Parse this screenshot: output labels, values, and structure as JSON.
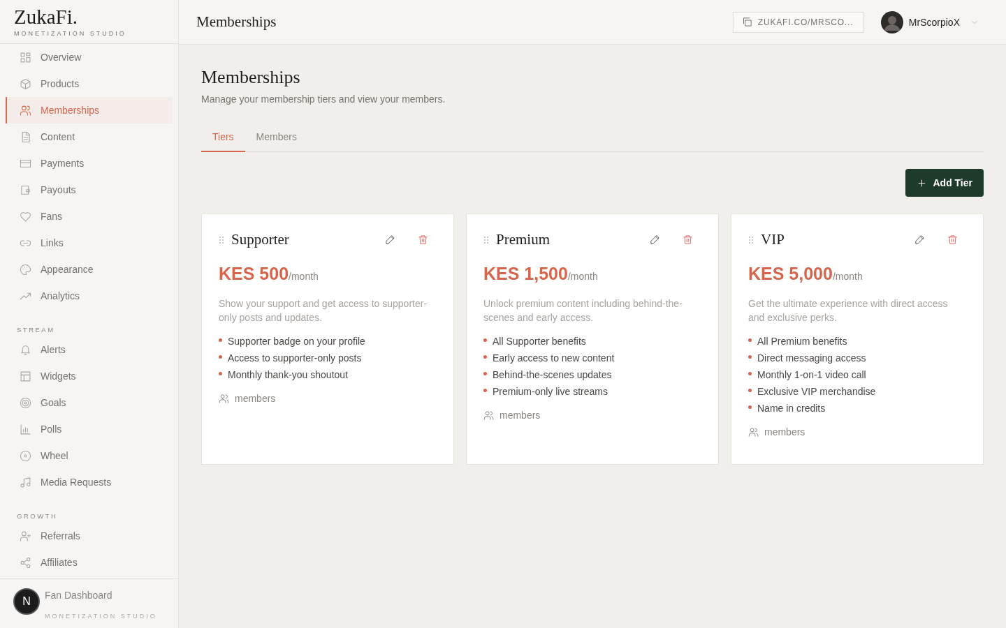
{
  "brand": {
    "name": "ZukaFi.",
    "tagline": "MONETIZATION STUDIO"
  },
  "sidebar": {
    "items": [
      {
        "label": "Overview",
        "selected": false
      },
      {
        "label": "Products",
        "selected": false
      },
      {
        "label": "Memberships",
        "selected": true
      },
      {
        "label": "Content",
        "selected": false
      },
      {
        "label": "Payments",
        "selected": false
      },
      {
        "label": "Payouts",
        "selected": false
      },
      {
        "label": "Fans",
        "selected": false
      },
      {
        "label": "Links",
        "selected": false
      },
      {
        "label": "Appearance",
        "selected": false
      },
      {
        "label": "Analytics",
        "selected": false
      }
    ],
    "sections": [
      {
        "title": "STREAM",
        "items": [
          {
            "label": "Alerts",
            "selected": false
          },
          {
            "label": "Widgets",
            "selected": false
          },
          {
            "label": "Goals",
            "selected": false
          },
          {
            "label": "Polls",
            "selected": false
          },
          {
            "label": "Wheel",
            "selected": false
          },
          {
            "label": "Media Requests",
            "selected": false
          }
        ]
      },
      {
        "title": "GROWTH",
        "items": [
          {
            "label": "Referrals",
            "selected": false
          },
          {
            "label": "Affiliates",
            "selected": false
          }
        ]
      }
    ],
    "footer": {
      "link": "Fan Dashboard",
      "tagline": "MONETIZATION STUDIO"
    }
  },
  "dev_badge": "N",
  "header": {
    "title": "Memberships",
    "link": "ZUKAFI.CO/MRSCO...",
    "user": "MrScorpioX"
  },
  "page": {
    "title": "Memberships",
    "subtitle": "Manage your membership tiers and view your members."
  },
  "tabs": [
    {
      "label": "Tiers",
      "selected": true
    },
    {
      "label": "Members",
      "selected": false
    }
  ],
  "add_button": "Add Tier",
  "tiers": [
    {
      "name": "Supporter",
      "price": "KES 500",
      "period": "/month",
      "description": "Show your support and get access to supporter-only posts and updates.",
      "benefits": [
        "Supporter badge on your profile",
        "Access to supporter-only posts",
        "Monthly thank-you shoutout"
      ],
      "members": "members"
    },
    {
      "name": "Premium",
      "price": "KES 1,500",
      "period": "/month",
      "description": "Unlock premium content including behind-the-scenes and early access.",
      "benefits": [
        "All Supporter benefits",
        "Early access to new content",
        "Behind-the-scenes updates",
        "Premium-only live streams"
      ],
      "members": "members"
    },
    {
      "name": "VIP",
      "price": "KES 5,000",
      "period": "/month",
      "description": "Get the ultimate experience with direct access and exclusive perks.",
      "benefits": [
        "All Premium benefits",
        "Direct messaging access",
        "Monthly 1-on-1 video call",
        "Exclusive VIP merchandise",
        "Name in credits"
      ],
      "members": "members"
    }
  ]
}
